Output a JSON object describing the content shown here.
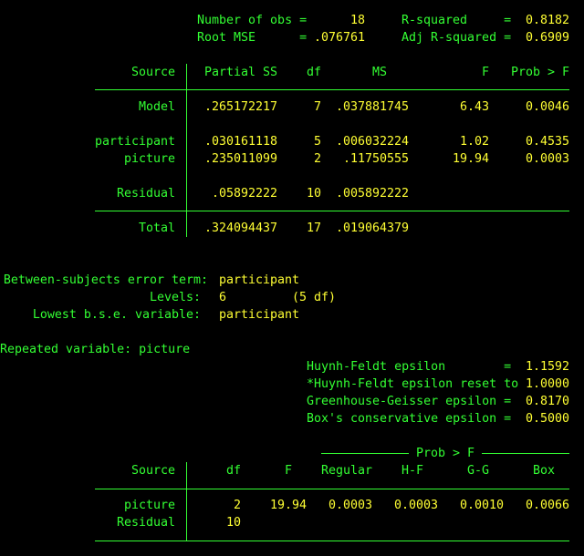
{
  "summary": {
    "nobs_label": "Number of obs =",
    "nobs_value": "18",
    "rsq_label": "R-squared     =",
    "rsq_value": "0.8182",
    "rmse_label": "Root MSE      =",
    "rmse_value": ".076761",
    "adjrsq_label": "Adj R-squared =",
    "adjrsq_value": "0.6909"
  },
  "anova": {
    "headers": [
      "Source",
      "Partial SS",
      "df",
      "MS",
      "F",
      "Prob > F"
    ],
    "rows": [
      [
        "Model",
        ".265172217",
        "7",
        ".037881745",
        "6.43",
        "0.0046"
      ],
      [
        "participant",
        ".030161118",
        "5",
        ".006032224",
        "1.02",
        "0.4535"
      ],
      [
        "picture",
        ".235011099",
        "2",
        ".11750555",
        "19.94",
        "0.0003"
      ],
      [
        "Residual",
        ".05892222",
        "10",
        ".005892222",
        "",
        ""
      ],
      [
        "Total",
        ".324094437",
        "17",
        ".019064379",
        "",
        ""
      ]
    ]
  },
  "bse": {
    "error_term_label": "Between-subjects error term:",
    "error_term_value": "participant",
    "levels_label": "Levels:",
    "levels_value": "6",
    "levels_df": "(5 df)",
    "lowest_label": "Lowest b.s.e. variable:",
    "lowest_value": "participant"
  },
  "repeated": {
    "label": "Repeated variable: picture",
    "epsilons": [
      {
        "label": "Huynh-Feldt epsilon        =",
        "value": "1.1592"
      },
      {
        "label": "*Huynh-Feldt epsilon reset to",
        "value": "1.0000"
      },
      {
        "label": "Greenhouse-Geisser epsilon =",
        "value": "0.8170"
      },
      {
        "label": "Box's conservative epsilon =",
        "value": "0.5000"
      }
    ]
  },
  "probtable": {
    "group_label": "Prob > F",
    "headers": [
      "Source",
      "df",
      "F",
      "Regular",
      "H-F",
      "G-G",
      "Box"
    ],
    "rows": [
      [
        "picture",
        "2",
        "19.94",
        "0.0003",
        "0.0003",
        "0.0010",
        "0.0066"
      ],
      [
        "Residual",
        "10",
        "",
        "",
        "",
        "",
        ""
      ]
    ]
  },
  "colors": {
    "label": "#33ff33",
    "value": "#ffff33",
    "background": "#000000"
  }
}
